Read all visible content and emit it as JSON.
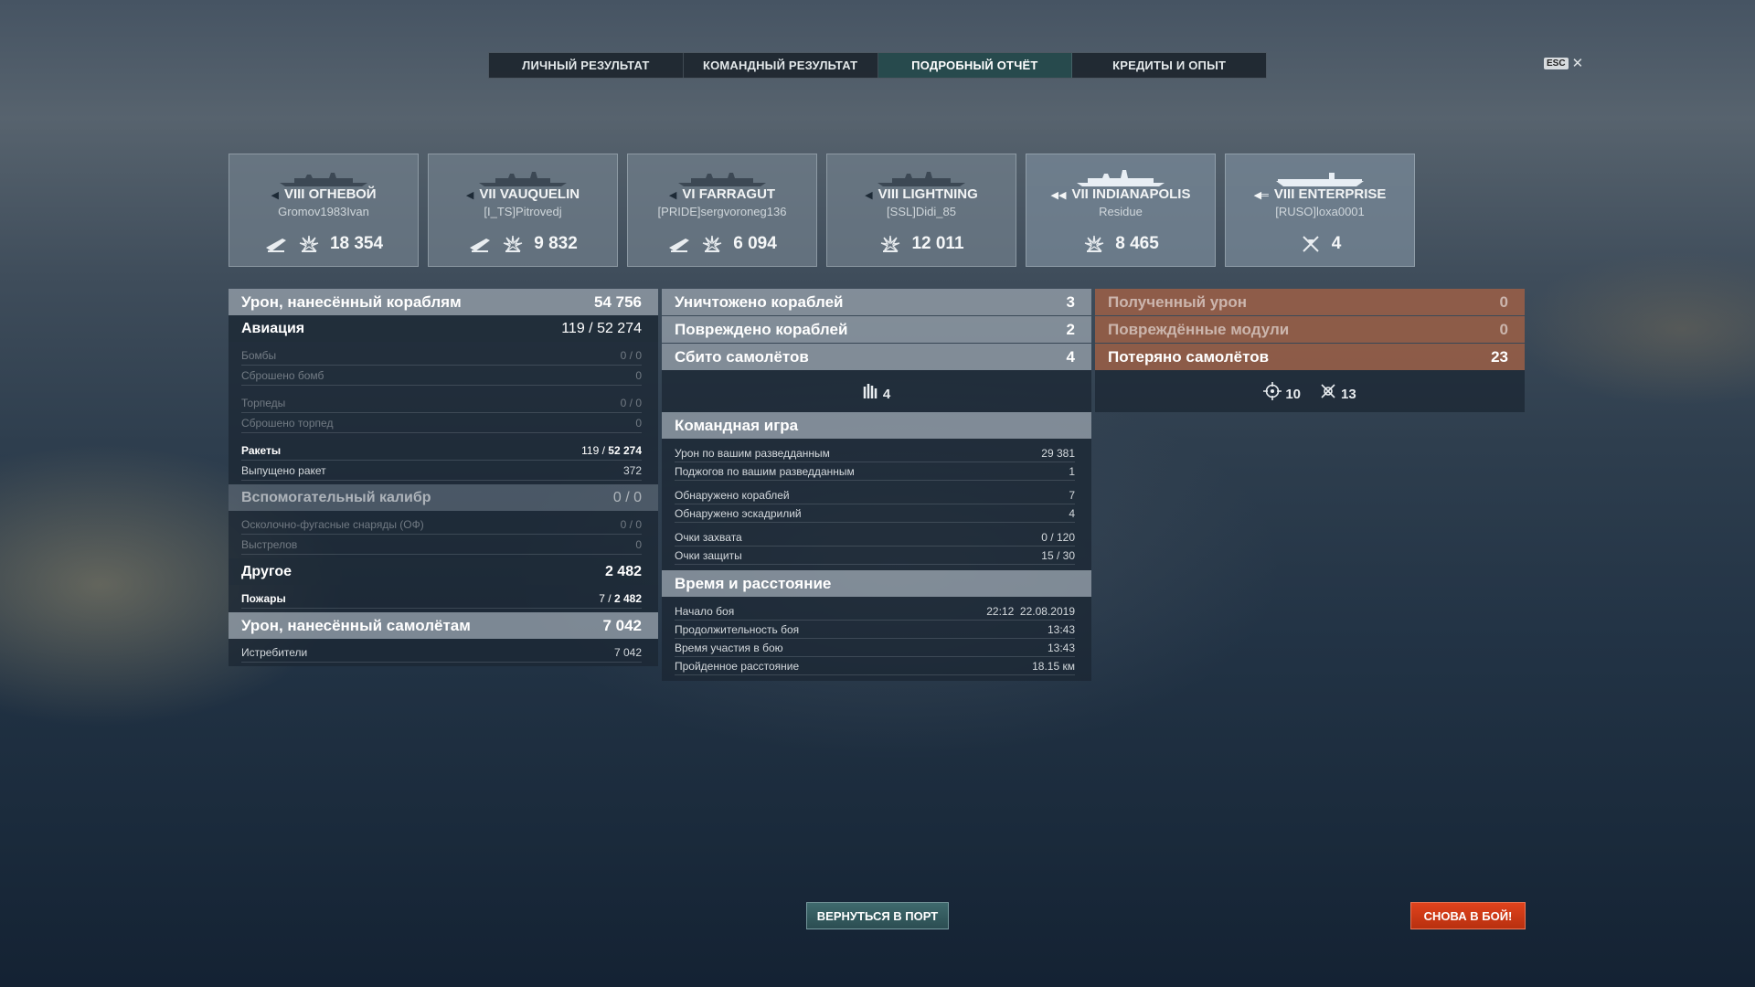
{
  "tabs": [
    {
      "label": "ЛИЧНЫЙ РЕЗУЛЬТАТ",
      "active": false
    },
    {
      "label": "КОМАНДНЫЙ РЕЗУЛЬТАТ",
      "active": false
    },
    {
      "label": "ПОДРОБНЫЙ ОТЧЁТ",
      "active": true
    },
    {
      "label": "КРЕДИТЫ И ОПЫТ",
      "active": false
    }
  ],
  "esc": {
    "key": "ESC",
    "close": "✕"
  },
  "ships": [
    {
      "tier_name": "VIII ОГНЕВОЙ",
      "player": "Gromov1983Ivan",
      "class_icon": "destroyer-icon",
      "stats": [
        {
          "icon": "torpedo-hit-icon",
          "value": ""
        },
        {
          "icon": "damage-icon",
          "value": "18 354"
        }
      ]
    },
    {
      "tier_name": "VII VAUQUELIN",
      "player": "[I_TS]Pitrovedj",
      "class_icon": "destroyer-icon",
      "stats": [
        {
          "icon": "torpedo-hit-icon",
          "value": ""
        },
        {
          "icon": "damage-icon",
          "value": "9 832"
        }
      ]
    },
    {
      "tier_name": "VI FARRAGUT",
      "player": "[PRIDE]sergvoroneg136",
      "class_icon": "destroyer-icon",
      "stats": [
        {
          "icon": "torpedo-hit-icon",
          "value": ""
        },
        {
          "icon": "damage-icon",
          "value": "6 094"
        }
      ]
    },
    {
      "tier_name": "VIII LIGHTNING",
      "player": "[SSL]Didi_85",
      "class_icon": "destroyer-icon",
      "stats": [
        {
          "icon": "damage-icon",
          "value": "12 011"
        }
      ]
    },
    {
      "tier_name": "VII INDIANAPOLIS",
      "player": "Residue",
      "class_icon": "cruiser-icon",
      "stats": [
        {
          "icon": "damage-icon",
          "value": "8 465"
        }
      ]
    },
    {
      "tier_name": "VIII ENTERPRISE",
      "player": "[RUSO]loxa0001",
      "class_icon": "carrier-icon",
      "stats": [
        {
          "icon": "plane-shot-icon",
          "value": "4"
        }
      ]
    }
  ],
  "damage": {
    "title": "Урон, нанесённый кораблям",
    "total": "54 756",
    "aviation": {
      "label": "Авиация",
      "value": "119 / 52 274"
    },
    "rows1": [
      {
        "label": "Бомбы",
        "value": "0 / 0",
        "style": "dim"
      },
      {
        "label": "Сброшено бомб",
        "value": "0",
        "style": "dim"
      }
    ],
    "rows2": [
      {
        "label": "Торпеды",
        "value": "0 / 0",
        "style": "dim"
      },
      {
        "label": "Сброшено торпед",
        "value": "0",
        "style": "dim"
      }
    ],
    "rockets": {
      "label": "Ракеты",
      "value_a": "119",
      "sep": " / ",
      "value_b": "52 274"
    },
    "rockets_fired": {
      "label": "Выпущено ракет",
      "value": "372"
    },
    "secondary": {
      "label": "Вспомогательный калибр",
      "value": "0 / 0"
    },
    "he_shells": {
      "label": "Осколочно-фугасные снаряды (ОФ)",
      "value": "0 / 0"
    },
    "shots": {
      "label": "Выстрелов",
      "value": "0"
    },
    "other": {
      "label": "Другое",
      "value": "2 482"
    },
    "fires": {
      "label": "Пожары",
      "value_a": "7",
      "sep": " / ",
      "value_b": "2 482"
    },
    "planes_dmg": {
      "label": "Урон, нанесённый самолётам",
      "value": "7 042"
    },
    "fighters": {
      "label": "Истребители",
      "value": "7 042"
    }
  },
  "mid": {
    "destroyed": {
      "label": "Уничтожено кораблей",
      "value": "3"
    },
    "damaged": {
      "label": "Повреждено кораблей",
      "value": "2"
    },
    "planes_down": {
      "label": "Сбито самолётов",
      "value": "4"
    },
    "planes_icon_value": "4",
    "team": {
      "title": "Командная игра",
      "rows": [
        {
          "label": "Урон по вашим разведданным",
          "value": "29 381"
        },
        {
          "label": "Поджогов по вашим разведданным",
          "value": "1"
        }
      ],
      "rows2": [
        {
          "label": "Обнаружено кораблей",
          "value": "7"
        },
        {
          "label": "Обнаружено эскадрилий",
          "value": "4"
        }
      ],
      "rows3": [
        {
          "label": "Очки захвата",
          "value": "0 / 120"
        },
        {
          "label": "Очки защиты",
          "value": "15 / 30"
        }
      ]
    },
    "time": {
      "title": "Время и расстояние",
      "rows": [
        {
          "label": "Начало боя",
          "value": "22:12  22.08.2019"
        },
        {
          "label": "Продолжительность боя",
          "value": "13:43"
        },
        {
          "label": "Время участия в бою",
          "value": "13:43"
        },
        {
          "label": "Пройденное расстояние",
          "value": "18.15 км"
        }
      ]
    }
  },
  "right": {
    "received": {
      "label": "Полученный урон",
      "value": "0"
    },
    "modules": {
      "label": "Повреждённые модули",
      "value": "0"
    },
    "lost_planes": {
      "label": "Потеряно самолётов",
      "value": "23"
    },
    "icon_a_value": "10",
    "icon_b_value": "13"
  },
  "buttons": {
    "port": "ВЕРНУТЬСЯ В ПОРТ",
    "battle": "СНОВА В БОЙ!"
  }
}
